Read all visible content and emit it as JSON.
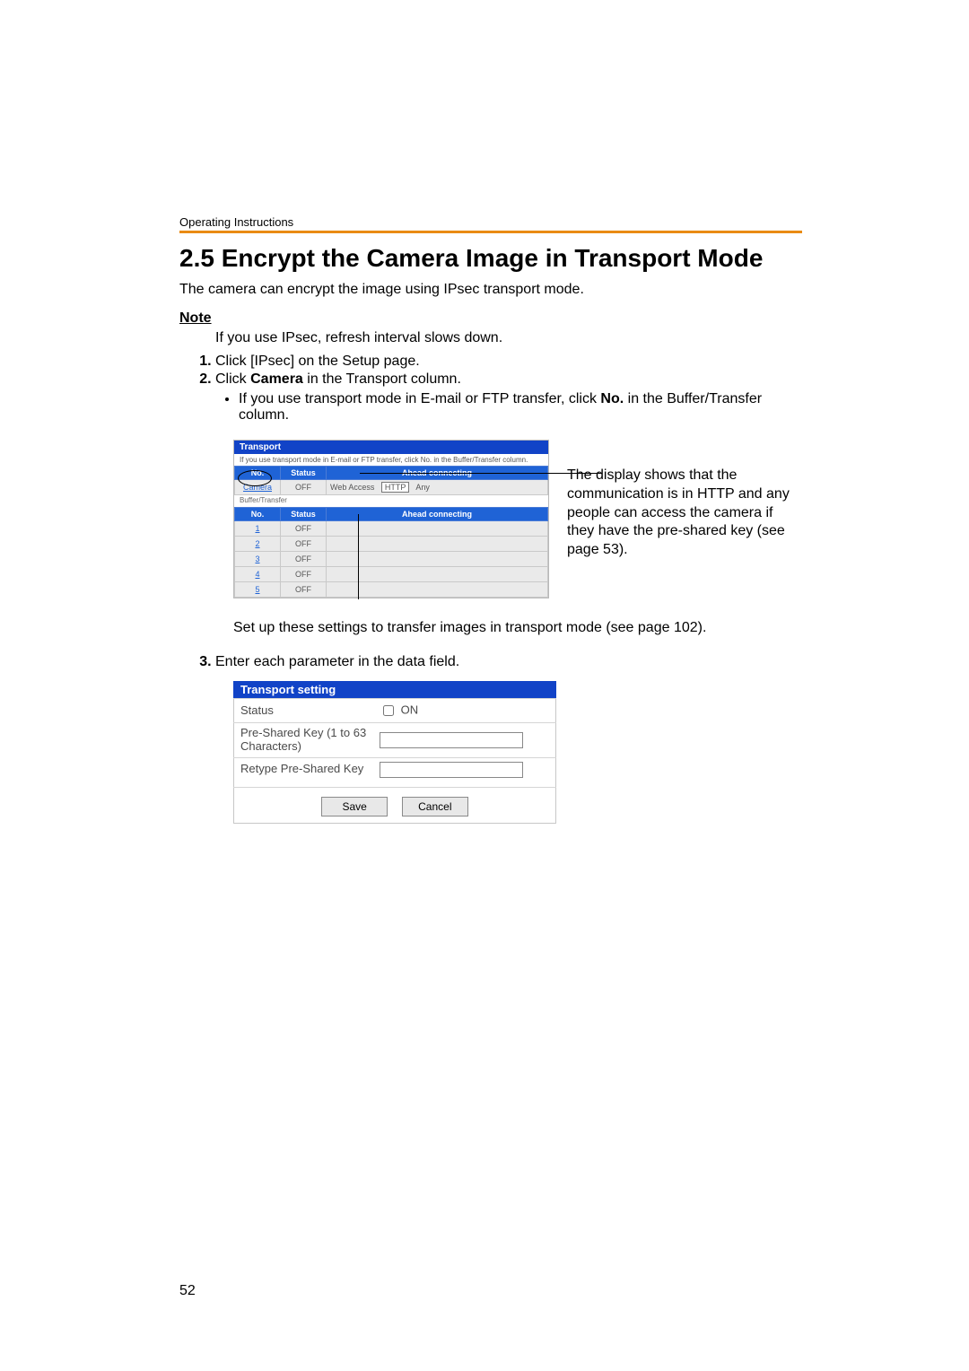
{
  "runningHeader": "Operating Instructions",
  "title": "2.5   Encrypt the Camera Image in Transport Mode",
  "intro": "The camera can encrypt the image using IPsec transport mode.",
  "noteHeading": "Note",
  "noteBody": "If you use IPsec, refresh interval slows down.",
  "steps": {
    "s1": "Click [IPsec] on the Setup page.",
    "s2_pre": "Click ",
    "s2_bold": "Camera",
    "s2_post": " in the Transport column.",
    "s2_sub_pre": "If you use transport mode in E-mail or FTP transfer, click ",
    "s2_sub_bold": "No.",
    "s2_sub_post": " in the Buffer/Transfer column.",
    "s3": "Enter each parameter in the data field."
  },
  "panel1": {
    "header": "Transport",
    "subtext": "If you use transport mode in E-mail or FTP transfer, click No. in the Buffer/Transfer column.",
    "cols": {
      "no": "No.",
      "status": "Status",
      "ahead": "Ahead connecting"
    },
    "cameraRow": {
      "no": "Camera",
      "status": "OFF",
      "meta1": "Web Access",
      "meta2": "HTTP",
      "meta3": "Any"
    },
    "sectionLabel": "Buffer/Transfer",
    "rows": [
      {
        "no": "1",
        "status": "OFF"
      },
      {
        "no": "2",
        "status": "OFF"
      },
      {
        "no": "3",
        "status": "OFF"
      },
      {
        "no": "4",
        "status": "OFF"
      },
      {
        "no": "5",
        "status": "OFF"
      }
    ]
  },
  "annotation": "The display shows that the communication is in HTTP and any people can access the camera if they have the pre-shared key (see page 53).",
  "caption": "Set up these settings to transfer images in transport mode (see page 102).",
  "panel2": {
    "header": "Transport setting",
    "statusLabel": "Status",
    "onLabel": "ON",
    "pskLabel": "Pre-Shared Key (1 to 63 Characters)",
    "repskLabel": "Retype Pre-Shared Key",
    "save": "Save",
    "cancel": "Cancel"
  },
  "pageNumber": "52"
}
